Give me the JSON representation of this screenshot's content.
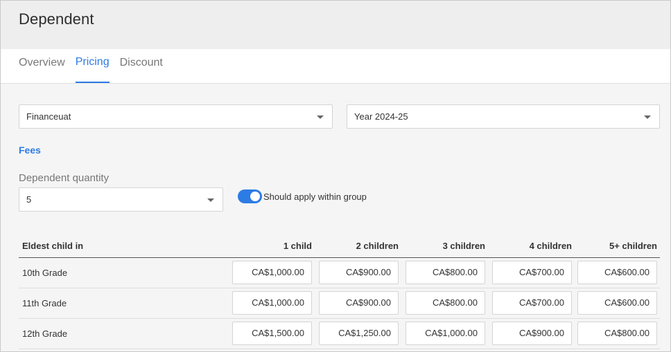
{
  "header": {
    "title": "Dependent"
  },
  "tabs": [
    {
      "label": "Overview",
      "active": false
    },
    {
      "label": "Pricing",
      "active": true
    },
    {
      "label": "Discount",
      "active": false
    }
  ],
  "filters": {
    "organization": "Financeuat",
    "year": "Year 2024-25"
  },
  "fees": {
    "section_label": "Fees",
    "dependent_quantity_label": "Dependent quantity",
    "dependent_quantity_value": "5",
    "toggle_label": "Should apply within group",
    "toggle_on": true
  },
  "table": {
    "headers": [
      "Eldest child in",
      "1 child",
      "2 children",
      "3 children",
      "4 children",
      "5+ children"
    ],
    "rows": [
      {
        "grade": "10th Grade",
        "prices": [
          "CA$1,000.00",
          "CA$900.00",
          "CA$800.00",
          "CA$700.00",
          "CA$600.00"
        ]
      },
      {
        "grade": "11th Grade",
        "prices": [
          "CA$1,000.00",
          "CA$900.00",
          "CA$800.00",
          "CA$700.00",
          "CA$600.00"
        ]
      },
      {
        "grade": "12th Grade",
        "prices": [
          "CA$1,500.00",
          "CA$1,250.00",
          "CA$1,000.00",
          "CA$900.00",
          "CA$800.00"
        ]
      }
    ]
  },
  "colors": {
    "accent": "#2d7be5",
    "header_bg": "#eeeeee",
    "page_bg": "#f5f5f5"
  }
}
